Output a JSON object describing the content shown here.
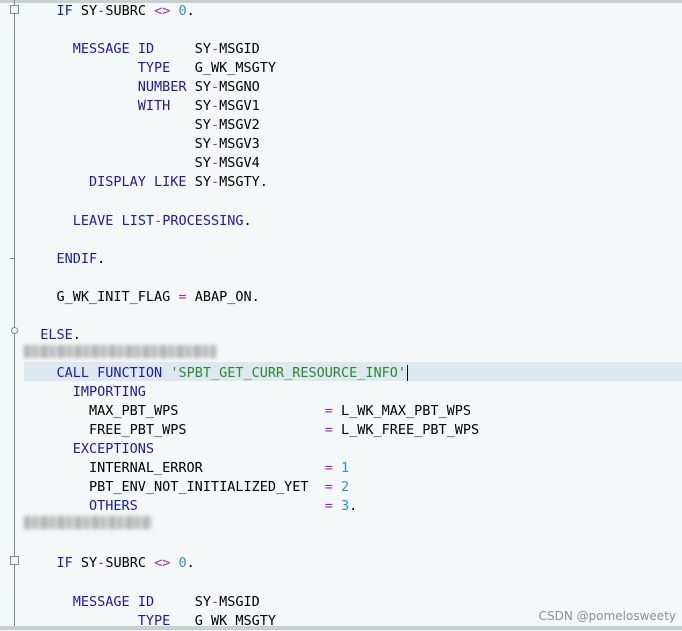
{
  "editor": {
    "lines": [
      {
        "t": "    IF SY-SUBRC <> 0."
      },
      {
        "t": ""
      },
      {
        "t": "      MESSAGE ID     SY-MSGID"
      },
      {
        "t": "              TYPE   G_WK_MSGTY"
      },
      {
        "t": "              NUMBER SY-MSGNO"
      },
      {
        "t": "              WITH   SY-MSGV1"
      },
      {
        "t": "                     SY-MSGV2"
      },
      {
        "t": "                     SY-MSGV3"
      },
      {
        "t": "                     SY-MSGV4"
      },
      {
        "t": "        DISPLAY LIKE SY-MSGTY."
      },
      {
        "t": ""
      },
      {
        "t": "      LEAVE LIST-PROCESSING."
      },
      {
        "t": ""
      },
      {
        "t": "    ENDIF."
      },
      {
        "t": ""
      },
      {
        "t": "    G_WK_INIT_FLAG = ABAP_ON."
      },
      {
        "t": ""
      },
      {
        "t": "  ELSE."
      },
      {
        "t": ""
      },
      {
        "t": "    CALL FUNCTION 'SPBT_GET_CURR_RESOURCE_INFO'"
      },
      {
        "t": "      IMPORTING"
      },
      {
        "t": "        MAX_PBT_WPS                  = L_WK_MAX_PBT_WPS"
      },
      {
        "t": "        FREE_PBT_WPS                 = L_WK_FREE_PBT_WPS"
      },
      {
        "t": "      EXCEPTIONS"
      },
      {
        "t": "        INTERNAL_ERROR               = 1"
      },
      {
        "t": "        PBT_ENV_NOT_INITIALIZED_YET  = 2"
      },
      {
        "t": "        OTHERS                       = 3."
      },
      {
        "t": ""
      },
      {
        "t": ""
      },
      {
        "t": "    IF SY-SUBRC <> 0."
      },
      {
        "t": ""
      },
      {
        "t": "      MESSAGE ID     SY-MSGID"
      },
      {
        "t": "              TYPE   G_WK_MSGTY"
      }
    ]
  },
  "watermark": "CSDN @pomelosweety",
  "colors": {
    "keyword": "#1a1aa6",
    "operator": "#9f2d9f",
    "number": "#2c90d6",
    "string": "#2b8b2b",
    "current_line": "#dde8f1",
    "background": "#f5f8f8"
  }
}
